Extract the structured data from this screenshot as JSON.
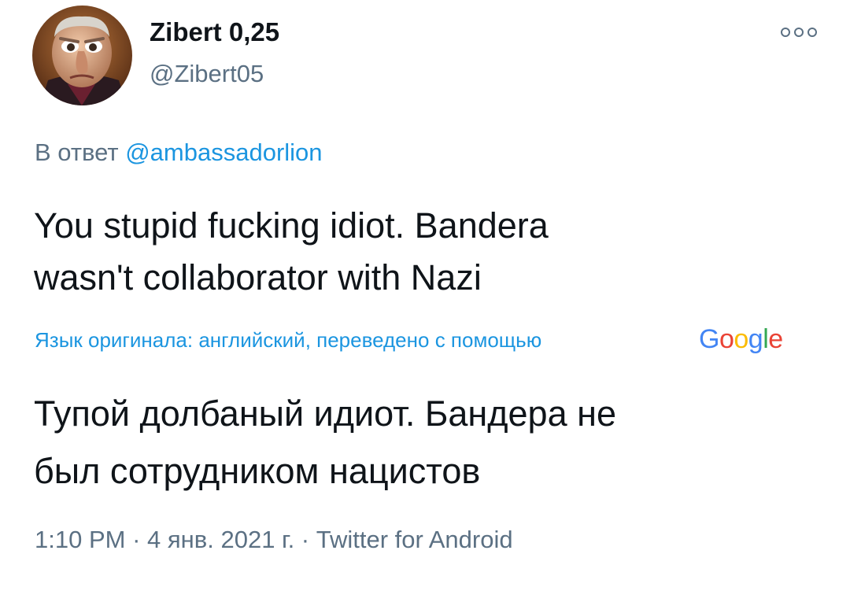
{
  "author": {
    "display_name": "Zibert 0,25",
    "handle": "@Zibert05"
  },
  "reply": {
    "prefix": "В ответ",
    "mention": "@ambassadorlion"
  },
  "tweet": {
    "text_line1": "You stupid fucking idiot. Bandera",
    "text_line2": "wasn't collaborator with Nazi"
  },
  "translation": {
    "note": "Язык оригинала: английский, переведено с помощью",
    "provider_logo": "Google",
    "text_line1": "Тупой долбаный идиот. Бандера не",
    "text_line2": "был сотрудником нацистов"
  },
  "meta": {
    "time": "1:10 PM",
    "separator1": " · ",
    "date": "4 янв. 2021 г.",
    "separator2": " · ",
    "source": "Twitter for Android"
  },
  "icons": {
    "more": "more-options-icon",
    "avatar": "avatar-image"
  },
  "colors": {
    "text": "#0f1419",
    "secondary": "#5b7083",
    "link": "#1b95e0"
  }
}
